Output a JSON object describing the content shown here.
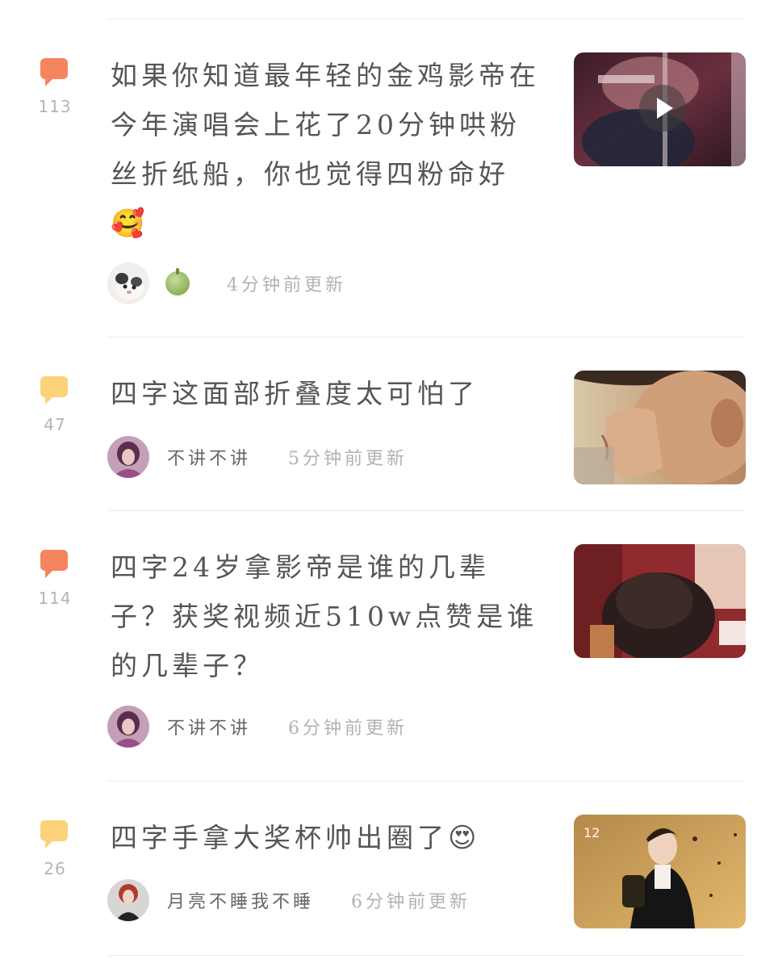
{
  "posts": [
    {
      "comment_count": "113",
      "title": "如果你知道最年轻的金鸡影帝在今年演唱会上花了20分钟哄粉丝折纸船，你也觉得四粉命好",
      "title_emoji": "🥰",
      "username": "",
      "badge_icon": "melon-icon",
      "updated": "4分钟前更新",
      "thumb_has_video": true
    },
    {
      "comment_count": "47",
      "title": "四字这面部折叠度太可怕了",
      "title_emoji": "",
      "username": "不讲不讲",
      "updated": "5分钟前更新",
      "thumb_has_video": false
    },
    {
      "comment_count": "114",
      "title": "四字24岁拿影帝是谁的几辈子？获奖视频近510w点赞是谁的几辈子？",
      "title_emoji": "",
      "username": "不讲不讲",
      "updated": "6分钟前更新",
      "thumb_has_video": false
    },
    {
      "comment_count": "26",
      "title": "四字手拿大奖杯帅出圈了",
      "title_emoji": "😍",
      "username": "月亮不睡我不睡",
      "updated": "6分钟前更新",
      "thumb_has_video": false
    }
  ],
  "colors": {
    "hot_bubble": "#f4855e",
    "warm_bubble": "#fcd27a",
    "title_text": "#555555",
    "meta_text": "#b2b2b2"
  }
}
